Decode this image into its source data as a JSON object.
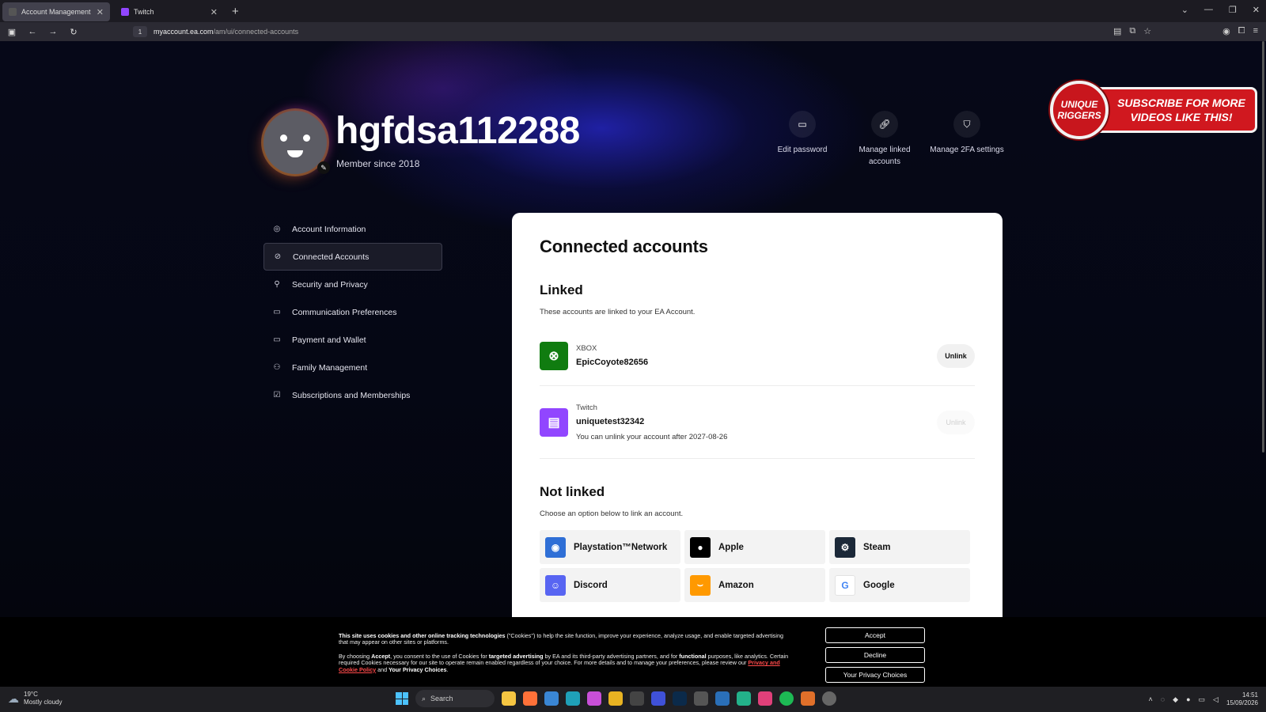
{
  "browser": {
    "tabs": [
      {
        "label": "Account Management",
        "active": true
      },
      {
        "label": "Twitch",
        "active": false
      }
    ],
    "new_tab": "+",
    "url_host": "myaccount.ea.com",
    "url_path": "/am/ui/connected-accounts",
    "site_info_badge": "1"
  },
  "promo": {
    "seal_text": "UNIQUE RIGGERS",
    "ribbon_text": "SUBSCRIBE FOR MORE VIDEOS LIKE THIS!"
  },
  "profile": {
    "username": "hgfdsa112288",
    "member_since": "Member since 2018"
  },
  "quick_actions": [
    {
      "label": "Edit password",
      "icon": "password-icon"
    },
    {
      "label": "Manage linked accounts",
      "icon": "link-icon"
    },
    {
      "label": "Manage 2FA settings",
      "icon": "shield-icon"
    }
  ],
  "sidebar": {
    "items": [
      {
        "label": "Account Information",
        "icon": "person-icon",
        "active": false
      },
      {
        "label": "Connected Accounts",
        "icon": "link-icon",
        "active": true
      },
      {
        "label": "Security and Privacy",
        "icon": "lock-person-icon",
        "active": false
      },
      {
        "label": "Communication Preferences",
        "icon": "chat-icon",
        "active": false
      },
      {
        "label": "Payment and Wallet",
        "icon": "card-icon",
        "active": false
      },
      {
        "label": "Family Management",
        "icon": "family-icon",
        "active": false
      },
      {
        "label": "Subscriptions and Memberships",
        "icon": "inbox-check-icon",
        "active": false
      }
    ]
  },
  "card": {
    "title": "Connected accounts",
    "linked_heading": "Linked",
    "linked_desc": "These accounts are linked to your EA Account.",
    "linked": [
      {
        "platform": "XBOX",
        "account": "EpicCoyote82656",
        "note": "",
        "button": "Unlink",
        "enabled": true,
        "color": "#107c10"
      },
      {
        "platform": "Twitch",
        "account": "uniquetest32342",
        "note": "You can unlink your account after 2027-08-26",
        "button": "Unlink",
        "enabled": false,
        "color": "#9146ff"
      }
    ],
    "not_linked_heading": "Not linked",
    "not_linked_desc": "Choose an option below to link an account.",
    "options": [
      {
        "label": "Playstation™Network",
        "icon": "playstation-icon",
        "color": "#2f6fd6"
      },
      {
        "label": "Apple",
        "icon": "apple-icon",
        "color": "#000000"
      },
      {
        "label": "Steam",
        "icon": "steam-icon",
        "color": "#1b2838"
      },
      {
        "label": "Discord",
        "icon": "discord-icon",
        "color": "#5865f2"
      },
      {
        "label": "Amazon",
        "icon": "amazon-icon",
        "color": "#ff9900"
      },
      {
        "label": "Google",
        "icon": "google-icon",
        "color": "#ffffff"
      }
    ]
  },
  "cookie": {
    "p1_bold": "This site uses cookies and other online tracking technologies",
    "p1_rest": " (\"Cookies\") to help the site function, improve your experience, analyze usage, and enable targeted advertising that may appear on other sites or platforms.",
    "p2_a": "By choosing ",
    "p2_accept": "Accept",
    "p2_b": ", you consent to the use of Cookies for ",
    "p2_targeted": "targeted advertising",
    "p2_c": " by EA and its third-party advertising partners, and for ",
    "p2_functional": "functional",
    "p2_d": " purposes, like analytics. Certain required Cookies necessary for our site to operate remain enabled regardless of your choice. For more details and to manage your preferences, please review our ",
    "p2_link": "Privacy and Cookie Policy",
    "p2_e": " and ",
    "p2_choices": "Your Privacy Choices",
    "p2_end": ".",
    "buttons": {
      "accept": "Accept",
      "decline": "Decline",
      "choices": "Your Privacy Choices"
    }
  },
  "taskbar": {
    "weather_temp": "19°C",
    "weather_desc": "Mostly cloudy",
    "search": "Search",
    "time": "14:51",
    "date": "15/09/2026"
  }
}
